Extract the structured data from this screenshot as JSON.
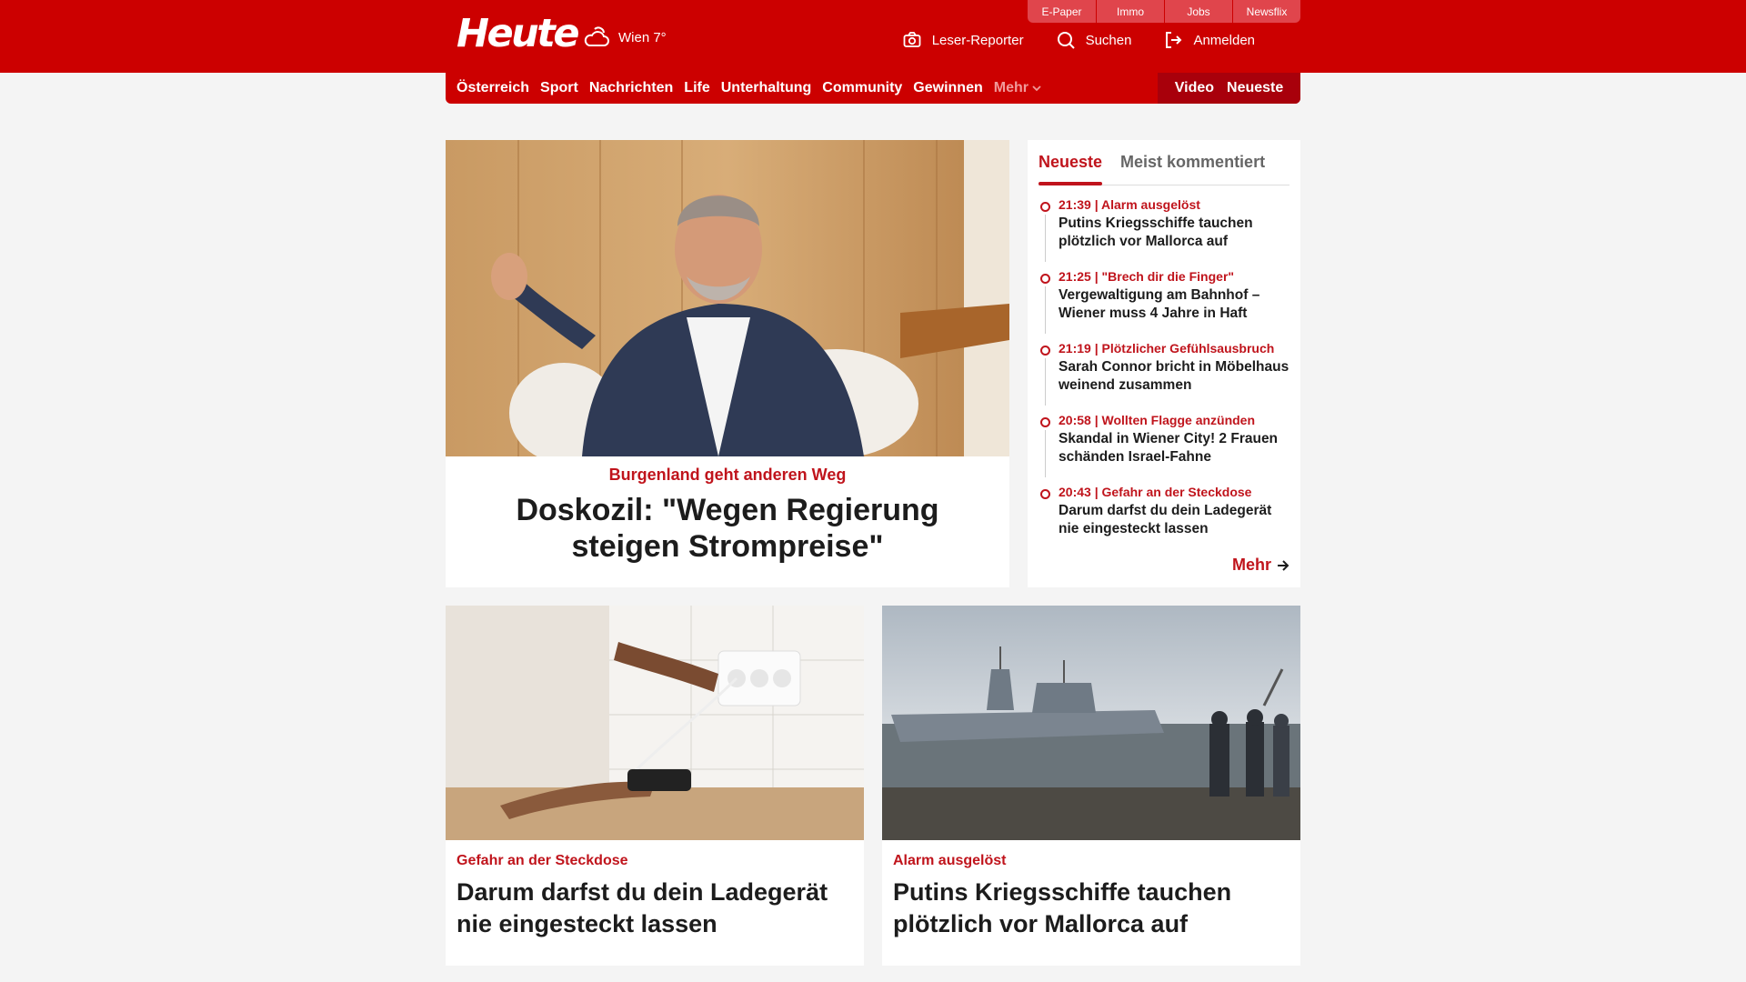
{
  "header": {
    "logo": "Heute",
    "weather": "Wien 7°",
    "util_tabs": [
      "E-Paper",
      "Immo",
      "Jobs",
      "Newsflix"
    ],
    "actions": {
      "reporter": "Leser-Reporter",
      "search": "Suchen",
      "login": "Anmelden"
    }
  },
  "nav": {
    "items": [
      "Österreich",
      "Sport",
      "Nachrichten",
      "Life",
      "Unterhaltung",
      "Community",
      "Gewinnen"
    ],
    "more": "Mehr",
    "video": "Video",
    "latest": "Neueste"
  },
  "hero": {
    "kicker": "Burgenland geht anderen Weg",
    "title": "Doskozil: \"Wegen Regierung steigen Strompreise\""
  },
  "sidebar": {
    "tabs": [
      "Neueste",
      "Meist kommentiert"
    ],
    "items": [
      {
        "time": "21:39 | Alarm ausgelöst",
        "title": "Putins Kriegsschiffe tauchen plötzlich vor Mallorca auf"
      },
      {
        "time": "21:25 | \"Brech dir die Finger\"",
        "title": "Vergewaltigung am Bahnhof – Wiener muss 4 Jahre in Haft"
      },
      {
        "time": "21:19 | Plötzlicher Gefühlsausbruch",
        "title": "Sarah Connor bricht in Möbelhaus weinend zusammen"
      },
      {
        "time": "20:58 | Wollten Flagge anzünden",
        "title": "Skandal in Wiener City! 2 Frauen schänden Israel-Fahne"
      },
      {
        "time": "20:43 | Gefahr an der Steckdose",
        "title": "Darum darfst du dein Ladegerät nie eingesteckt lassen"
      }
    ],
    "more": "Mehr"
  },
  "cards": [
    {
      "kicker": "Gefahr an der Steckdose",
      "title": "Darum darfst du dein Ladegerät nie eingesteckt lassen"
    },
    {
      "kicker": "Alarm ausgelöst",
      "title": "Putins Kriegsschiffe tauchen plötzlich vor Mallorca auf"
    }
  ],
  "colors": {
    "brand_red": "#cc0000",
    "accent_red": "#c0141c",
    "dark_red": "#a8000b"
  }
}
